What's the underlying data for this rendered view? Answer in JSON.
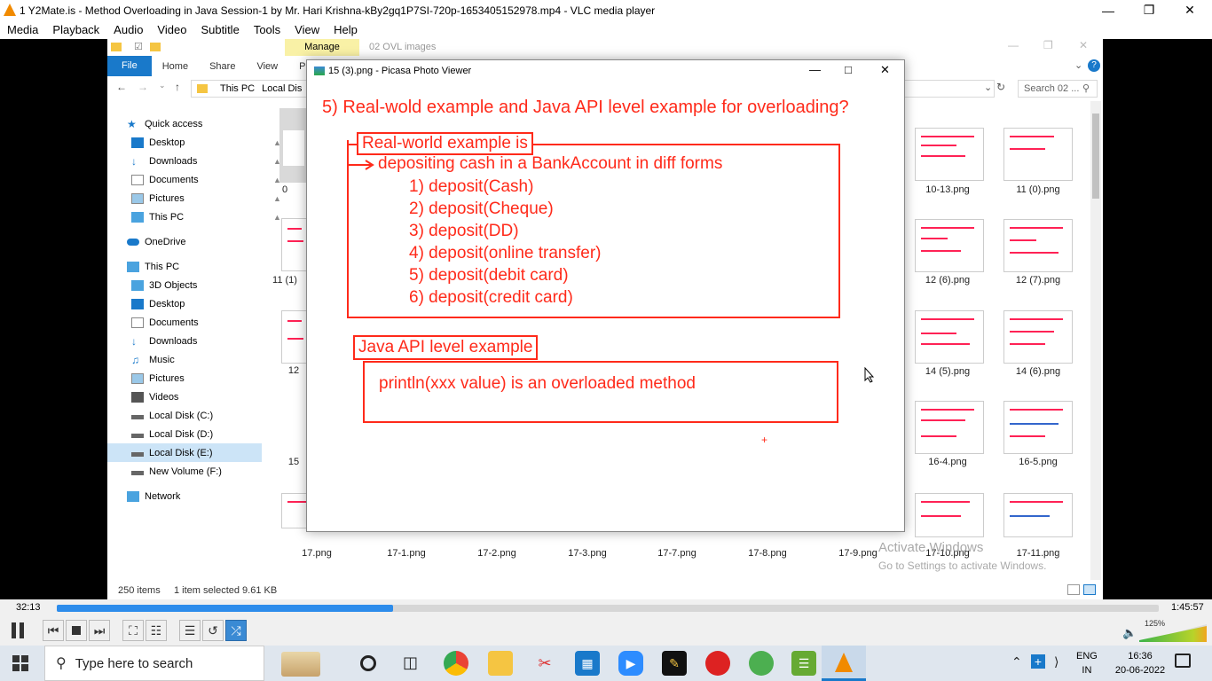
{
  "vlc": {
    "window_title": "1 Y2Mate.is - Method Overloading in Java  Session-1  by Mr. Hari Krishna-kBy2gq1P7SI-720p-1653405152978.mp4 - VLC media player",
    "menu": [
      "Media",
      "Playback",
      "Audio",
      "Video",
      "Subtitle",
      "Tools",
      "View",
      "Help"
    ],
    "time_elapsed": "32:13",
    "time_total": "1:45:57",
    "progress": 0.305,
    "volume": "125%"
  },
  "explorer": {
    "ribbon_context": "Manage",
    "ribbon_context_title": "02 OVL images",
    "tabs": [
      "File",
      "Home",
      "Share",
      "View",
      "Pic"
    ],
    "address": [
      "This PC",
      "Local Dis"
    ],
    "search_placeholder": "Search 02 ...",
    "nav": {
      "quick_access": "Quick access",
      "quick_items": [
        "Desktop",
        "Downloads",
        "Documents",
        "Pictures",
        "This PC"
      ],
      "onedrive": "OneDrive",
      "this_pc": "This PC",
      "pc_items": [
        "3D Objects",
        "Desktop",
        "Documents",
        "Downloads",
        "Music",
        "Pictures",
        "Videos",
        "Local Disk (C:)",
        "Local Disk (D:)",
        "Local Disk (E:)",
        "New Volume (F:)"
      ],
      "network": "Network"
    },
    "left_partial_labels": [
      "0",
      "11 (1)",
      "12",
      "15"
    ],
    "right_files": [
      "10-13.png",
      "11 (0).png",
      "12 (6).png",
      "12 (7).png",
      "14 (5).png",
      "14 (6).png",
      "16-4.png",
      "16-5.png"
    ],
    "bottom_files": [
      "17.png",
      "17-1.png",
      "17-2.png",
      "17-3.png",
      "17-7.png",
      "17-8.png",
      "17-9.png",
      "17-10.png",
      "17-11.png"
    ],
    "status_items": "250 items",
    "status_selected": "1 item selected  9.61 KB"
  },
  "picasa": {
    "title": "15 (3).png - Picasa Photo Viewer",
    "heading": "5) Real-wold example and Java API level example for overloading?",
    "box1_label": "Real-world example is",
    "box1_line": "depositing cash in a BankAccount in diff forms",
    "deposits": [
      "1) deposit(Cash)",
      "2) deposit(Cheque)",
      "3) deposit(DD)",
      "4) deposit(online transfer)",
      "5) deposit(debit card)",
      "6) deposit(credit card)"
    ],
    "box2_label": "Java API level example",
    "box2_line": "println(xxx value) is an overloaded method"
  },
  "watermark": {
    "line1": "Activate Windows",
    "line2": "Go to Settings to activate Windows."
  },
  "taskbar": {
    "search_placeholder": "Type here to search",
    "lang1": "ENG",
    "lang2": "IN",
    "time": "16:36",
    "date": "20-06-2022"
  }
}
